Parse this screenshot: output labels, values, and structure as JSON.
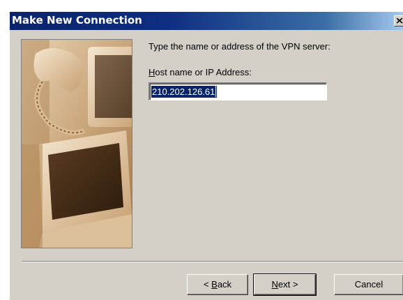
{
  "window": {
    "title": "Make New Connection",
    "close_icon": "close-icon"
  },
  "form": {
    "prompt": "Type the name or address of the VPN server:",
    "host_label_mnemonic": "H",
    "host_label_rest": "ost name or IP Address:",
    "host_value": "210.202.126.61"
  },
  "buttons": {
    "back_prefix": "< ",
    "back_mnemonic": "B",
    "back_rest": "ack",
    "next_mnemonic": "N",
    "next_rest": "ext >",
    "cancel": "Cancel"
  },
  "colors": {
    "titlebar_start": "#0a246a",
    "titlebar_end": "#a6caf0",
    "dialog_face": "#d4d0c8",
    "selection": "#0a246a"
  },
  "illustration": {
    "icon": "computer-monitors-illustration"
  }
}
